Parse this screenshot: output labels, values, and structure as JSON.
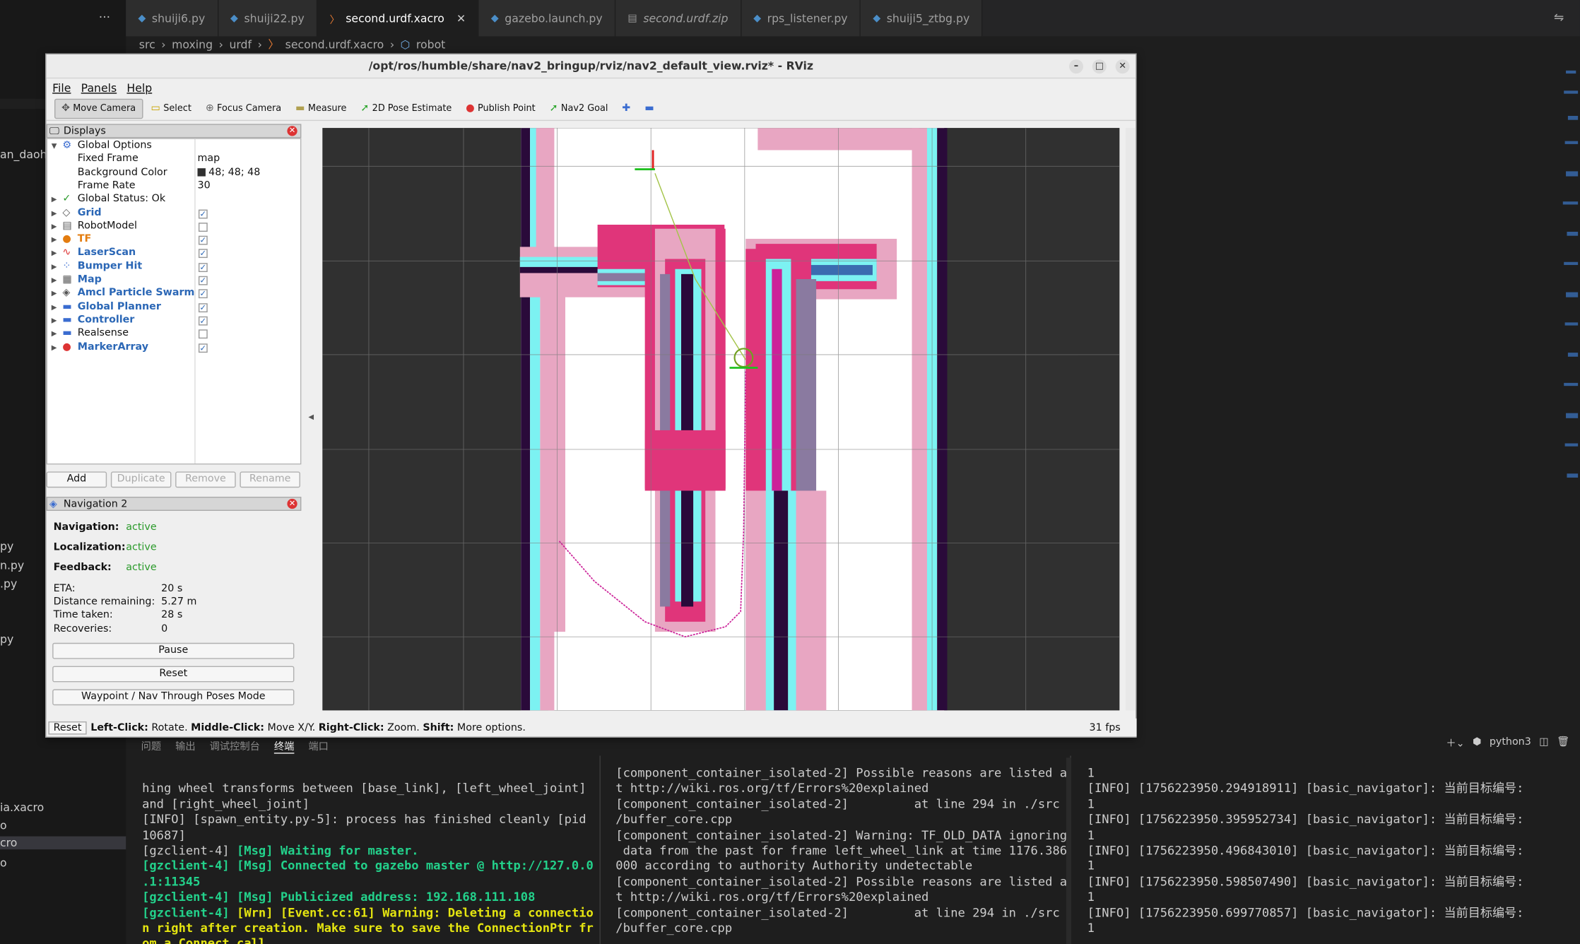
{
  "editor": {
    "tabs": [
      {
        "label": "shuiji6.py",
        "active": false
      },
      {
        "label": "shuiji22.py",
        "active": false
      },
      {
        "label": "second.urdf.xacro",
        "active": true
      },
      {
        "label": "gazebo.launch.py",
        "active": false
      },
      {
        "label": "second.urdf.zip",
        "active": false
      },
      {
        "label": "rps_listener.py",
        "active": false
      },
      {
        "label": "shuiji5_ztbg.py",
        "active": false
      }
    ],
    "breadcrumb": [
      "src",
      "moxing",
      "urdf",
      "second.urdf.xacro",
      "robot"
    ],
    "explorer_fragments": [
      "an_daoh",
      "py",
      "n.py",
      ".py",
      "py",
      "ia.xacro",
      "o",
      "cro",
      "o"
    ]
  },
  "rviz": {
    "title": "/opt/ros/humble/share/nav2_bringup/rviz/nav2_default_view.rviz* - RViz",
    "menu": [
      "File",
      "Panels",
      "Help"
    ],
    "toolbar": [
      "Move Camera",
      "Select",
      "Focus Camera",
      "Measure",
      "2D Pose Estimate",
      "Publish Point",
      "Nav2 Goal"
    ],
    "displays_title": "Displays",
    "displays": [
      {
        "label": "Global Options",
        "style": "",
        "value": ""
      },
      {
        "label": "Fixed Frame",
        "style": "",
        "value": "map"
      },
      {
        "label": "Background Color",
        "style": "",
        "value": "48; 48; 48"
      },
      {
        "label": "Frame Rate",
        "style": "",
        "value": "30"
      },
      {
        "label": "Global Status: Ok",
        "style": "",
        "value": ""
      },
      {
        "label": "Grid",
        "style": "blue",
        "checked": true
      },
      {
        "label": "RobotModel",
        "style": "",
        "checked": false
      },
      {
        "label": "TF",
        "style": "orange",
        "checked": true
      },
      {
        "label": "LaserScan",
        "style": "blue",
        "checked": true
      },
      {
        "label": "Bumper Hit",
        "style": "blue",
        "checked": true
      },
      {
        "label": "Map",
        "style": "blue",
        "checked": true
      },
      {
        "label": "Amcl Particle Swarm",
        "style": "blue",
        "checked": true
      },
      {
        "label": "Global Planner",
        "style": "blue",
        "checked": true
      },
      {
        "label": "Controller",
        "style": "blue",
        "checked": true
      },
      {
        "label": "Realsense",
        "style": "",
        "checked": false
      },
      {
        "label": "MarkerArray",
        "style": "blue",
        "checked": true
      }
    ],
    "display_buttons": [
      "Add",
      "Duplicate",
      "Remove",
      "Rename"
    ],
    "nav_title": "Navigation 2",
    "nav_status": [
      {
        "label": "Navigation:",
        "value": "active"
      },
      {
        "label": "Localization:",
        "value": "active"
      },
      {
        "label": "Feedback:",
        "value": "active"
      }
    ],
    "nav_metrics": [
      {
        "label": "ETA:",
        "value": "20 s"
      },
      {
        "label": "Distance remaining:",
        "value": "5.27 m"
      },
      {
        "label": "Time taken:",
        "value": "28 s"
      },
      {
        "label": "Recoveries:",
        "value": "0"
      }
    ],
    "nav_buttons": [
      "Pause",
      "Reset",
      "Waypoint / Nav Through Poses Mode"
    ],
    "status": {
      "reset": "Reset",
      "hint_bold1": "Left-Click:",
      "hint1": " Rotate. ",
      "hint_bold2": "Middle-Click:",
      "hint2": " Move X/Y. ",
      "hint_bold3": "Right-Click:",
      "hint3": " Zoom. ",
      "hint_bold4": "Shift:",
      "hint4": " More options.",
      "fps": "31 fps"
    },
    "colors": {
      "background": "#303030",
      "costmap_pink": "#e8a6c2",
      "lethal": "#2a0a3a",
      "inflation": "#e0357a",
      "cyan": "#7cf2f2"
    }
  },
  "terminal": {
    "tabs": [
      "问题",
      "输出",
      "调试控制台",
      "终端",
      "端口"
    ],
    "python_label": "python3",
    "pane1": [
      {
        "t": "hing wheel transforms between [base_link], [left_wheel_joint]"
      },
      {
        "t": "and [right_wheel_joint]"
      },
      {
        "t": "[INFO] [spawn_entity.py-5]: process has finished cleanly [pid"
      },
      {
        "t": "10687]"
      },
      {
        "t": "[gzclient-4] [Msg] Waiting for master."
      },
      {
        "t": "[gzclient-4] [Msg] Connected to gazebo master @ http://127.0.0"
      },
      {
        "t": ".1:11345"
      },
      {
        "t": "[gzclient-4] [Msg] Publicized address: 192.168.111.108"
      },
      {
        "t": "[gzclient-4] [Wrn] [Event.cc:61] Warning: Deleting a connectio"
      },
      {
        "t": "n right after creation. Make sure to save the ConnectionPtr fr"
      },
      {
        "t": "om a Connect call"
      }
    ],
    "pane2": [
      "[component_container_isolated-2] Possible reasons are listed a",
      "t http://wiki.ros.org/tf/Errors%20explained",
      "[component_container_isolated-2]         at line 294 in ./src",
      "/buffer_core.cpp",
      "[component_container_isolated-2] Warning: TF_OLD_DATA ignoring",
      " data from the past for frame left_wheel_link at time 1176.386",
      "000 according to authority Authority undetectable",
      "[component_container_isolated-2] Possible reasons are listed a",
      "t http://wiki.ros.org/tf/Errors%20explained",
      "[component_container_isolated-2]         at line 294 in ./src",
      "/buffer_core.cpp"
    ],
    "pane3": [
      "1",
      "[INFO] [1756223950.294918911] [basic_navigator]: 当前目标编号:",
      "1",
      "[INFO] [1756223950.395952734] [basic_navigator]: 当前目标编号:",
      "1",
      "[INFO] [1756223950.496843010] [basic_navigator]: 当前目标编号:",
      "1",
      "[INFO] [1756223950.598507490] [basic_navigator]: 当前目标编号:",
      "1",
      "[INFO] [1756223950.699770857] [basic_navigator]: 当前目标编号:",
      "1"
    ]
  }
}
